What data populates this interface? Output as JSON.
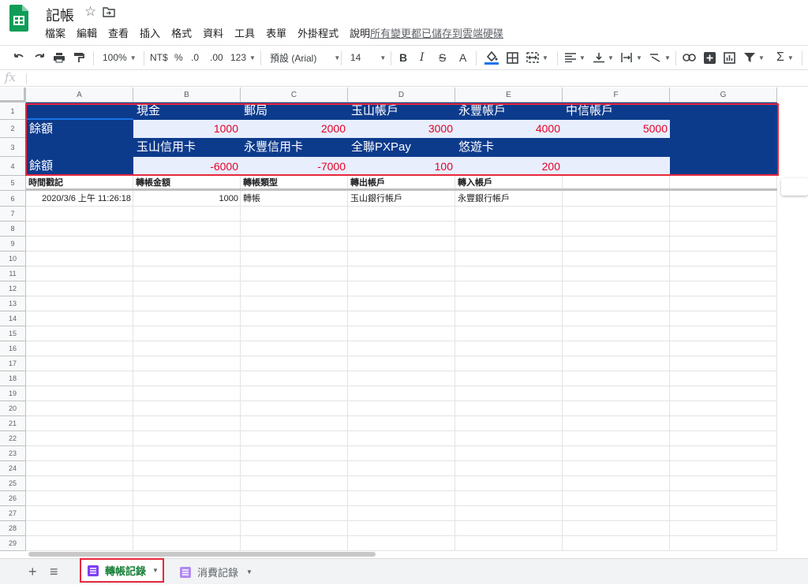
{
  "doc": {
    "title": "記帳",
    "star_icon": "star-icon",
    "folder_icon": "folder-move-icon",
    "save_status": "所有變更都已儲存到雲端硬碟"
  },
  "menu": [
    "檔案",
    "編輯",
    "查看",
    "插入",
    "格式",
    "資料",
    "工具",
    "表單",
    "外掛程式",
    "說明"
  ],
  "toolbar": {
    "zoom": "100%",
    "currency": "NT$",
    "percent": "%",
    "decrease_decimal": ".0",
    "increase_decimal": ".00",
    "more_formats": "123",
    "font": "預設 (Arial)",
    "font_size": "14",
    "bold": "B",
    "italic": "I",
    "strike": "S",
    "text_color": "A",
    "sum": "Σ"
  },
  "formula_bar": {
    "fx": "fx",
    "value": ""
  },
  "columns": [
    "A",
    "B",
    "C",
    "D",
    "E",
    "F",
    "G"
  ],
  "rows": [
    "1",
    "2",
    "3",
    "4",
    "5",
    "6",
    "7",
    "8",
    "9",
    "10",
    "11",
    "12",
    "13",
    "14",
    "15",
    "16",
    "17",
    "18",
    "19",
    "20",
    "21",
    "22",
    "23",
    "24",
    "25",
    "26",
    "27",
    "28",
    "29"
  ],
  "sheet": {
    "r1": [
      "",
      "現金",
      "郵局",
      "玉山帳戶",
      "永豐帳戶",
      "中信帳戶"
    ],
    "r2": [
      "餘額",
      "1000",
      "2000",
      "3000",
      "4000",
      "5000"
    ],
    "r3": [
      "",
      "玉山信用卡",
      "永豐信用卡",
      "全聯PXPay",
      "悠遊卡"
    ],
    "r4": [
      "餘額",
      "-6000",
      "-7000",
      "100",
      "200",
      ""
    ],
    "r5": [
      "時間戳記",
      "轉帳金額",
      "轉帳類型",
      "轉出帳戶",
      "轉入帳戶"
    ],
    "r6": [
      "2020/3/6 上午 11:26:18",
      "1000",
      "轉帳",
      "玉山銀行帳戶",
      "永豐銀行帳戶"
    ]
  },
  "tabs": {
    "add": "+",
    "list": "≡",
    "active": "轉帳記錄",
    "inactive": "消費記錄"
  },
  "colors": {
    "header_blue": "#0d3b8c",
    "light_blue": "#e8eefc",
    "value_red": "#e60026",
    "highlight": "#e8273c",
    "tab_green": "#188038",
    "tab_purple": "#7e3ff2"
  }
}
